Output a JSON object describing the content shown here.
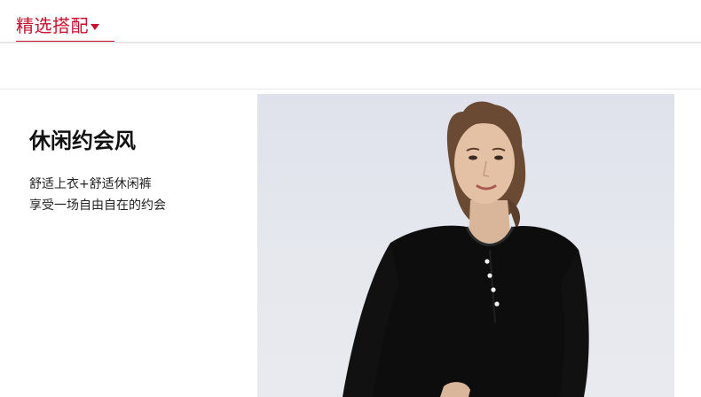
{
  "section_tab": {
    "label": "精选搭配",
    "icon": "caret-down-icon",
    "accent_color": "#c8102e"
  },
  "outfit": {
    "title": "休闲约会风",
    "description_lines": [
      "舒适上衣+舒适休闲裤",
      "享受一场自由自在的约会"
    ]
  }
}
